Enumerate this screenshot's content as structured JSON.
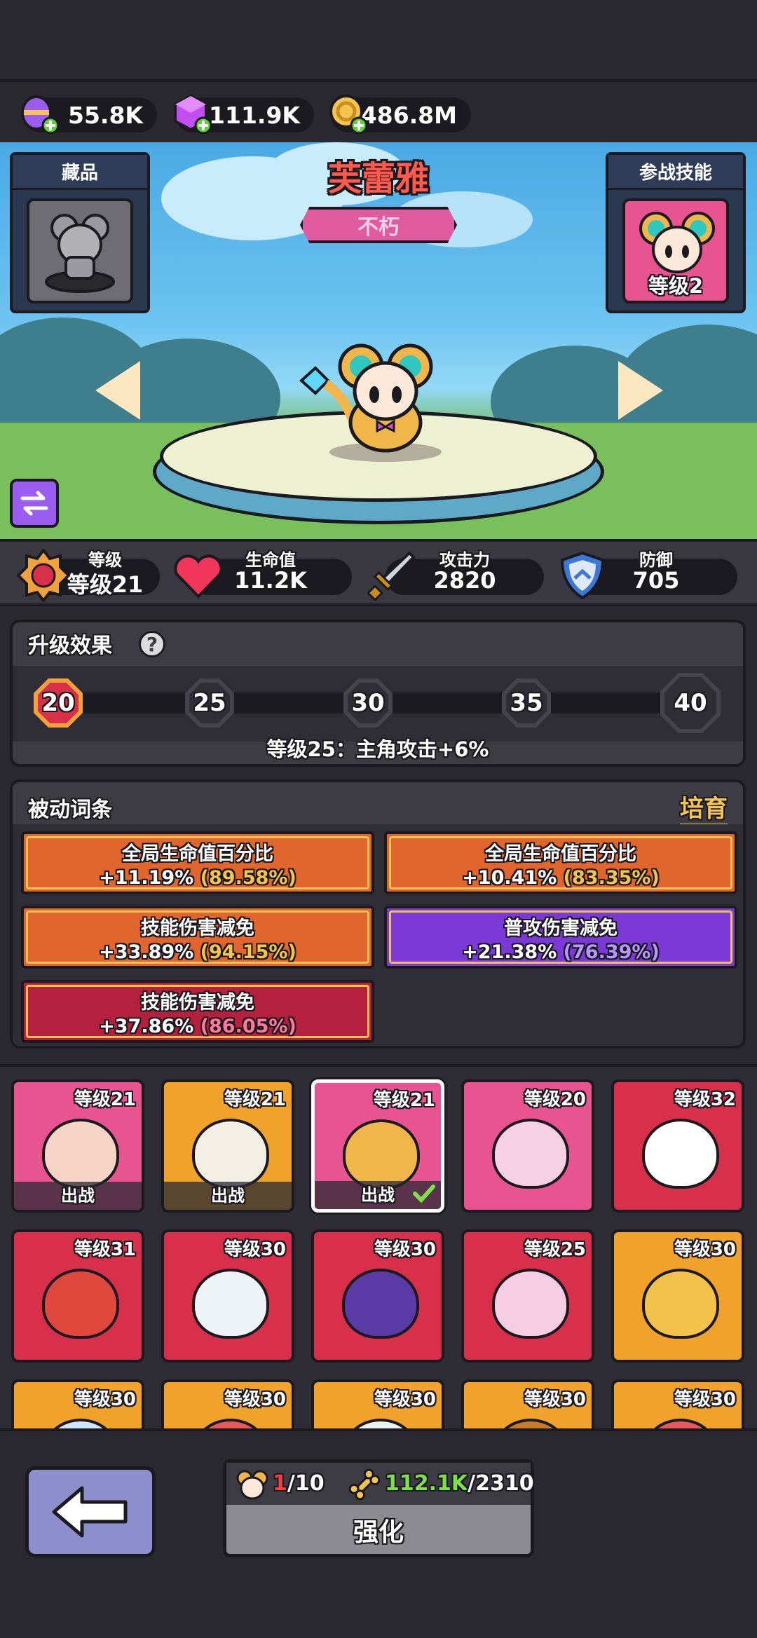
{
  "currencies": [
    {
      "icon": "purple-egg-icon",
      "value": "55.8K"
    },
    {
      "icon": "purple-cube-icon",
      "value": "111.9K"
    },
    {
      "icon": "gold-coin-icon",
      "value": "486.8M"
    }
  ],
  "hero": {
    "name": "芙蕾雅",
    "rarity": "不朽",
    "collection_label": "藏品",
    "skill_label": "参战技能",
    "skill_level": "等级2"
  },
  "stats": [
    {
      "label": "等级",
      "value": "等级21",
      "icon": "level-badge-icon"
    },
    {
      "label": "生命值",
      "value": "11.2K",
      "icon": "heart-icon"
    },
    {
      "label": "攻击力",
      "value": "2820",
      "icon": "sword-icon"
    },
    {
      "label": "防御",
      "value": "705",
      "icon": "shield-icon"
    }
  ],
  "upgrade": {
    "title": "升级效果",
    "milestones": [
      "20",
      "25",
      "30",
      "35",
      "40"
    ],
    "current_milestone": "20",
    "progress": 0.04,
    "description": "等级25：主角攻击+6%"
  },
  "passives": {
    "title": "被动词条",
    "cultivate_label": "培育",
    "items": [
      {
        "name": "全局生命值百分比",
        "value": "+11.19%",
        "cap": "(89.58%)",
        "tier": "orange"
      },
      {
        "name": "全局生命值百分比",
        "value": "+10.41%",
        "cap": "(83.35%)",
        "tier": "orange"
      },
      {
        "name": "技能伤害减免",
        "value": "+33.89%",
        "cap": "(94.15%)",
        "tier": "orange"
      },
      {
        "name": "普攻伤害减免",
        "value": "+21.38%",
        "cap": "(76.39%)",
        "tier": "purple"
      },
      {
        "name": "技能伤害减免",
        "value": "+37.86%",
        "cap": "(86.05%)",
        "tier": "red"
      }
    ]
  },
  "pets": [
    {
      "level": "等级21",
      "deployed": "出战",
      "bg": "#e8548f",
      "blob": "#f6d5c6"
    },
    {
      "level": "等级21",
      "deployed": "出战",
      "bg": "#f0a22b",
      "blob": "#f4efe4"
    },
    {
      "level": "等级21",
      "deployed": "出战",
      "bg": "#e8548f",
      "blob": "#f0b64a",
      "selected": true
    },
    {
      "level": "等级20",
      "deployed": "",
      "bg": "#e8548f",
      "blob": "#f6d1e6"
    },
    {
      "level": "等级32",
      "deployed": "",
      "bg": "#d8304a",
      "blob": "#ffffff"
    },
    {
      "level": "等级31",
      "deployed": "",
      "bg": "#d8304a",
      "blob": "#e0473d"
    },
    {
      "level": "等级30",
      "deployed": "",
      "bg": "#d8304a",
      "blob": "#eef3f8"
    },
    {
      "level": "等级30",
      "deployed": "",
      "bg": "#d8304a",
      "blob": "#5a3ba6"
    },
    {
      "level": "等级25",
      "deployed": "",
      "bg": "#d8304a",
      "blob": "#f6cde2"
    },
    {
      "level": "等级30",
      "deployed": "",
      "bg": "#f0a22b",
      "blob": "#f2c24b"
    },
    {
      "level": "等级30",
      "deployed": "",
      "bg": "#f0a22b",
      "blob": "#cfe9f8"
    },
    {
      "level": "等级30",
      "deployed": "",
      "bg": "#f0a22b",
      "blob": "#e85a5a"
    },
    {
      "level": "等级30",
      "deployed": "",
      "bg": "#f0a22b",
      "blob": "#e8f4f0"
    },
    {
      "level": "等级30",
      "deployed": "",
      "bg": "#f0a22b",
      "blob": "#c77a2a"
    },
    {
      "level": "等级30",
      "deployed": "",
      "bg": "#f0a22b",
      "blob": "#e85a5a"
    }
  ],
  "enhance": {
    "shards_have": "1",
    "shards_need": "/10",
    "bones_have": "112.1K",
    "bones_need": "/2310",
    "label": "强化"
  },
  "colors": {
    "accent_gold": "#f3c451",
    "pink_name": "#ff5a4d",
    "rarity_pink": "#e05aa0"
  }
}
